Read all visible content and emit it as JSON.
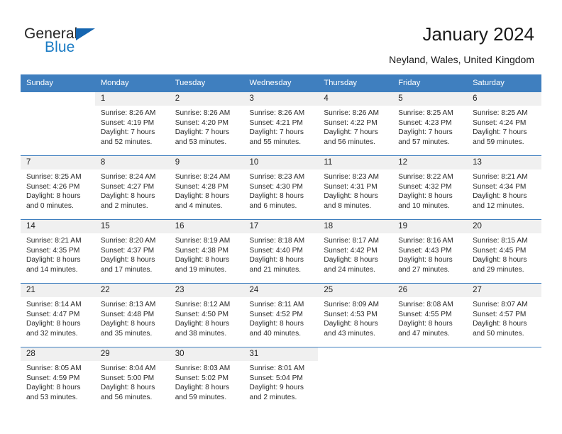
{
  "brand": {
    "name_part1": "General",
    "name_part2": "Blue",
    "triangle_icon": "triangle-icon",
    "accent_color": "#1a7bc4",
    "header_color": "#3f7fbf"
  },
  "header": {
    "title": "January 2024",
    "subtitle": "Neyland, Wales, United Kingdom"
  },
  "calendar": {
    "weekdays": [
      "Sunday",
      "Monday",
      "Tuesday",
      "Wednesday",
      "Thursday",
      "Friday",
      "Saturday"
    ],
    "labels": {
      "sunrise": "Sunrise:",
      "sunset": "Sunset:",
      "daylight": "Daylight:"
    },
    "weeks": [
      [
        {
          "day": "",
          "sunrise": "",
          "sunset": "",
          "daylight_line1": "",
          "daylight_line2": ""
        },
        {
          "day": "1",
          "sunrise": "Sunrise: 8:26 AM",
          "sunset": "Sunset: 4:19 PM",
          "daylight_line1": "Daylight: 7 hours",
          "daylight_line2": "and 52 minutes."
        },
        {
          "day": "2",
          "sunrise": "Sunrise: 8:26 AM",
          "sunset": "Sunset: 4:20 PM",
          "daylight_line1": "Daylight: 7 hours",
          "daylight_line2": "and 53 minutes."
        },
        {
          "day": "3",
          "sunrise": "Sunrise: 8:26 AM",
          "sunset": "Sunset: 4:21 PM",
          "daylight_line1": "Daylight: 7 hours",
          "daylight_line2": "and 55 minutes."
        },
        {
          "day": "4",
          "sunrise": "Sunrise: 8:26 AM",
          "sunset": "Sunset: 4:22 PM",
          "daylight_line1": "Daylight: 7 hours",
          "daylight_line2": "and 56 minutes."
        },
        {
          "day": "5",
          "sunrise": "Sunrise: 8:25 AM",
          "sunset": "Sunset: 4:23 PM",
          "daylight_line1": "Daylight: 7 hours",
          "daylight_line2": "and 57 minutes."
        },
        {
          "day": "6",
          "sunrise": "Sunrise: 8:25 AM",
          "sunset": "Sunset: 4:24 PM",
          "daylight_line1": "Daylight: 7 hours",
          "daylight_line2": "and 59 minutes."
        }
      ],
      [
        {
          "day": "7",
          "sunrise": "Sunrise: 8:25 AM",
          "sunset": "Sunset: 4:26 PM",
          "daylight_line1": "Daylight: 8 hours",
          "daylight_line2": "and 0 minutes."
        },
        {
          "day": "8",
          "sunrise": "Sunrise: 8:24 AM",
          "sunset": "Sunset: 4:27 PM",
          "daylight_line1": "Daylight: 8 hours",
          "daylight_line2": "and 2 minutes."
        },
        {
          "day": "9",
          "sunrise": "Sunrise: 8:24 AM",
          "sunset": "Sunset: 4:28 PM",
          "daylight_line1": "Daylight: 8 hours",
          "daylight_line2": "and 4 minutes."
        },
        {
          "day": "10",
          "sunrise": "Sunrise: 8:23 AM",
          "sunset": "Sunset: 4:30 PM",
          "daylight_line1": "Daylight: 8 hours",
          "daylight_line2": "and 6 minutes."
        },
        {
          "day": "11",
          "sunrise": "Sunrise: 8:23 AM",
          "sunset": "Sunset: 4:31 PM",
          "daylight_line1": "Daylight: 8 hours",
          "daylight_line2": "and 8 minutes."
        },
        {
          "day": "12",
          "sunrise": "Sunrise: 8:22 AM",
          "sunset": "Sunset: 4:32 PM",
          "daylight_line1": "Daylight: 8 hours",
          "daylight_line2": "and 10 minutes."
        },
        {
          "day": "13",
          "sunrise": "Sunrise: 8:21 AM",
          "sunset": "Sunset: 4:34 PM",
          "daylight_line1": "Daylight: 8 hours",
          "daylight_line2": "and 12 minutes."
        }
      ],
      [
        {
          "day": "14",
          "sunrise": "Sunrise: 8:21 AM",
          "sunset": "Sunset: 4:35 PM",
          "daylight_line1": "Daylight: 8 hours",
          "daylight_line2": "and 14 minutes."
        },
        {
          "day": "15",
          "sunrise": "Sunrise: 8:20 AM",
          "sunset": "Sunset: 4:37 PM",
          "daylight_line1": "Daylight: 8 hours",
          "daylight_line2": "and 17 minutes."
        },
        {
          "day": "16",
          "sunrise": "Sunrise: 8:19 AM",
          "sunset": "Sunset: 4:38 PM",
          "daylight_line1": "Daylight: 8 hours",
          "daylight_line2": "and 19 minutes."
        },
        {
          "day": "17",
          "sunrise": "Sunrise: 8:18 AM",
          "sunset": "Sunset: 4:40 PM",
          "daylight_line1": "Daylight: 8 hours",
          "daylight_line2": "and 21 minutes."
        },
        {
          "day": "18",
          "sunrise": "Sunrise: 8:17 AM",
          "sunset": "Sunset: 4:42 PM",
          "daylight_line1": "Daylight: 8 hours",
          "daylight_line2": "and 24 minutes."
        },
        {
          "day": "19",
          "sunrise": "Sunrise: 8:16 AM",
          "sunset": "Sunset: 4:43 PM",
          "daylight_line1": "Daylight: 8 hours",
          "daylight_line2": "and 27 minutes."
        },
        {
          "day": "20",
          "sunrise": "Sunrise: 8:15 AM",
          "sunset": "Sunset: 4:45 PM",
          "daylight_line1": "Daylight: 8 hours",
          "daylight_line2": "and 29 minutes."
        }
      ],
      [
        {
          "day": "21",
          "sunrise": "Sunrise: 8:14 AM",
          "sunset": "Sunset: 4:47 PM",
          "daylight_line1": "Daylight: 8 hours",
          "daylight_line2": "and 32 minutes."
        },
        {
          "day": "22",
          "sunrise": "Sunrise: 8:13 AM",
          "sunset": "Sunset: 4:48 PM",
          "daylight_line1": "Daylight: 8 hours",
          "daylight_line2": "and 35 minutes."
        },
        {
          "day": "23",
          "sunrise": "Sunrise: 8:12 AM",
          "sunset": "Sunset: 4:50 PM",
          "daylight_line1": "Daylight: 8 hours",
          "daylight_line2": "and 38 minutes."
        },
        {
          "day": "24",
          "sunrise": "Sunrise: 8:11 AM",
          "sunset": "Sunset: 4:52 PM",
          "daylight_line1": "Daylight: 8 hours",
          "daylight_line2": "and 40 minutes."
        },
        {
          "day": "25",
          "sunrise": "Sunrise: 8:09 AM",
          "sunset": "Sunset: 4:53 PM",
          "daylight_line1": "Daylight: 8 hours",
          "daylight_line2": "and 43 minutes."
        },
        {
          "day": "26",
          "sunrise": "Sunrise: 8:08 AM",
          "sunset": "Sunset: 4:55 PM",
          "daylight_line1": "Daylight: 8 hours",
          "daylight_line2": "and 47 minutes."
        },
        {
          "day": "27",
          "sunrise": "Sunrise: 8:07 AM",
          "sunset": "Sunset: 4:57 PM",
          "daylight_line1": "Daylight: 8 hours",
          "daylight_line2": "and 50 minutes."
        }
      ],
      [
        {
          "day": "28",
          "sunrise": "Sunrise: 8:05 AM",
          "sunset": "Sunset: 4:59 PM",
          "daylight_line1": "Daylight: 8 hours",
          "daylight_line2": "and 53 minutes."
        },
        {
          "day": "29",
          "sunrise": "Sunrise: 8:04 AM",
          "sunset": "Sunset: 5:00 PM",
          "daylight_line1": "Daylight: 8 hours",
          "daylight_line2": "and 56 minutes."
        },
        {
          "day": "30",
          "sunrise": "Sunrise: 8:03 AM",
          "sunset": "Sunset: 5:02 PM",
          "daylight_line1": "Daylight: 8 hours",
          "daylight_line2": "and 59 minutes."
        },
        {
          "day": "31",
          "sunrise": "Sunrise: 8:01 AM",
          "sunset": "Sunset: 5:04 PM",
          "daylight_line1": "Daylight: 9 hours",
          "daylight_line2": "and 2 minutes."
        },
        {
          "day": "",
          "sunrise": "",
          "sunset": "",
          "daylight_line1": "",
          "daylight_line2": ""
        },
        {
          "day": "",
          "sunrise": "",
          "sunset": "",
          "daylight_line1": "",
          "daylight_line2": ""
        },
        {
          "day": "",
          "sunrise": "",
          "sunset": "",
          "daylight_line1": "",
          "daylight_line2": ""
        }
      ]
    ]
  }
}
